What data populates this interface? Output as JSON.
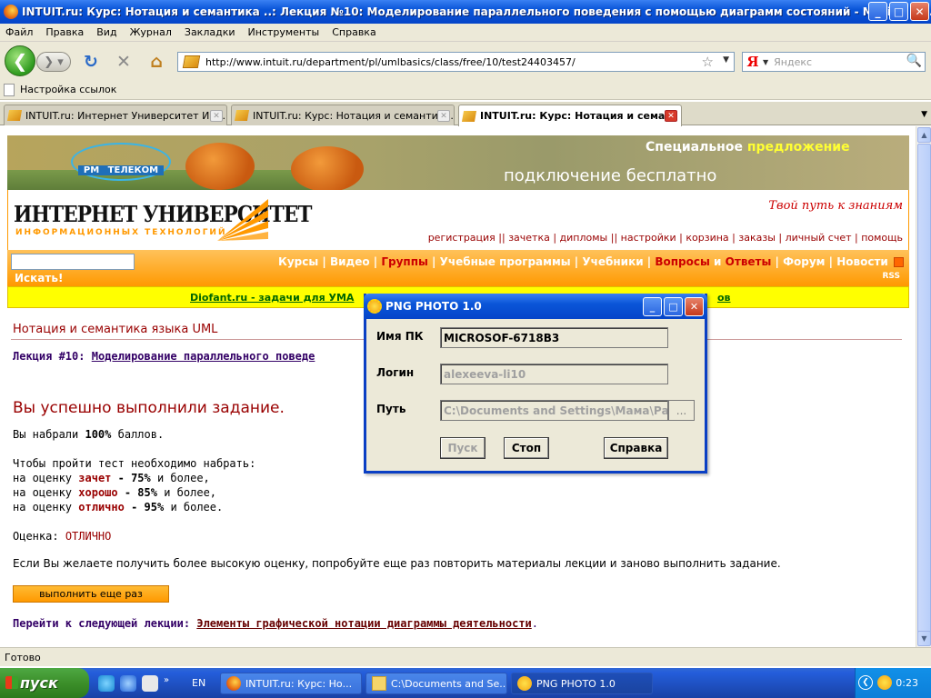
{
  "window": {
    "title": "INTUIT.ru: Курс: Нотация и семантика ..: Лекция №10: Моделирование параллельного поведения с помощью диаграмм состояний - Mozilla Fi...",
    "controls": [
      "_",
      "□",
      "✕"
    ]
  },
  "menu": [
    "Файл",
    "Правка",
    "Вид",
    "Журнал",
    "Закладки",
    "Инструменты",
    "Справка"
  ],
  "nav": {
    "url": "http://www.intuit.ru/department/pl/umlbasics/class/free/10/test24403457/",
    "search_placeholder": "Яндекс",
    "search_engine_letter": "Я"
  },
  "bookmarks": {
    "item": "Настройка ссылок"
  },
  "tabs": [
    {
      "label": "INTUIT.ru: Интернет Университет Ин..."
    },
    {
      "label": "INTUIT.ru: Курс: Нотация и семантик..."
    },
    {
      "label": "INTUIT.ru: Курс: Нотация и сема..."
    }
  ],
  "banner": {
    "brand": "ТЕЛЕКОМ",
    "brand_prefix": "РМ",
    "line1a": "Специальное",
    "line1b": "предложение",
    "line2": "подключение бесплатно"
  },
  "site": {
    "logo_main": "ИНТЕРНЕТ УНИВЕРСИТЕТ",
    "logo_sub": "ИНФОРМАЦИОННЫХ ТЕХНОЛОГИЙ",
    "slogan": "Твой путь к знаниям",
    "toplinks": "регистрация || зачетка | дипломы || настройки | корзина | заказы | личный счет | помощь",
    "search_button": "Искать!",
    "menu_a": "Курсы | Видео |",
    "menu_groups": "Группы",
    "menu_b": "| Учебные программы | Учебники |",
    "menu_qa1": "Вопросы",
    "menu_qa2": "и",
    "menu_qa3": "Ответы",
    "menu_c": "| Форум | Новости",
    "rss": "RSS",
    "ad_link": "Diofant.ru - задачи для УМА",
    "ad_link_end": "ов"
  },
  "content": {
    "course_title": "Нотация и семантика языка UML",
    "lecture_prefix": "Лекция #10:",
    "lecture_link": "Моделирование параллельного поведе",
    "success": "Вы успешно выполнили задание.",
    "score_pre": "Вы набрали",
    "score_val": "100%",
    "score_post": "баллов.",
    "need": "Чтобы пройти тест необходимо набрать:",
    "g1_pre": "на оценку",
    "g1_name": "зачет",
    "g1_val": "- 75%",
    "g1_post": "и более,",
    "g2_pre": "на оценку",
    "g2_name": "хорошо",
    "g2_val": "- 85%",
    "g2_post": "и более,",
    "g3_pre": "на оценку",
    "g3_name": "отлично",
    "g3_val": "- 95%",
    "g3_post": "и более.",
    "grade_label": "Оценка:",
    "grade_value": "ОТЛИЧНО",
    "retry_text": "Если Вы желаете получить более высокую оценку, попробуйте еще раз повторить материалы лекции и заново выполнить задание.",
    "retry_button": "выполнить еще раз",
    "next_label": "Перейти к следующей лекции:",
    "next_link": "Элементы графической нотации диаграммы деятельности",
    "next_dot": "."
  },
  "status": "Готово",
  "dialog": {
    "title": "PNG PHOTO 1.0",
    "pc_label": "Имя ПК",
    "pc_value": "MICROSOF-6718B3",
    "login_label": "Логин",
    "login_value": "alexeeva-li10",
    "path_label": "Путь",
    "path_value": "C:\\Documents and Settings\\Мама\\Раб",
    "browse": "...",
    "start": "Пуск",
    "stop": "Стоп",
    "help": "Справка"
  },
  "taskbar": {
    "start": "пуск",
    "lang": "EN",
    "tasks": [
      {
        "label": "INTUIT.ru: Курс: Но..."
      },
      {
        "label": "C:\\Documents and Se..."
      },
      {
        "label": "PNG PHOTO 1.0"
      }
    ],
    "clock": "0:23"
  }
}
